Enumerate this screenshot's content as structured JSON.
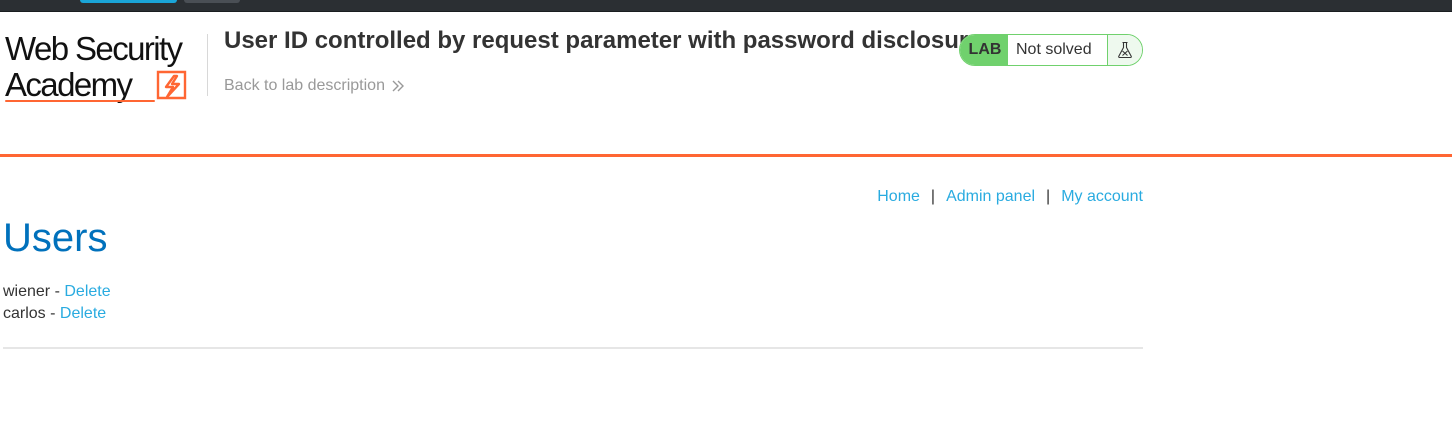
{
  "lab": {
    "title": "User ID controlled by request parameter with password disclosure",
    "back_link": "Back to lab description",
    "badge": "LAB",
    "status": "Not solved",
    "status_icon": "flask-icon"
  },
  "logo": {
    "line1": "Web Security",
    "line2": "Academy",
    "icon": "lightning-bolt-icon"
  },
  "nav": {
    "home": "Home",
    "admin": "Admin panel",
    "account": "My account",
    "separator": "|"
  },
  "page": {
    "heading": "Users"
  },
  "users": [
    {
      "name": "wiener",
      "separator": " - ",
      "action": "Delete"
    },
    {
      "name": "carlos",
      "separator": " - ",
      "action": "Delete"
    }
  ],
  "colors": {
    "accent_orange": "#ff6633",
    "status_green": "#70d16d",
    "link_blue": "#29abe0",
    "heading_blue": "#0071bc"
  }
}
